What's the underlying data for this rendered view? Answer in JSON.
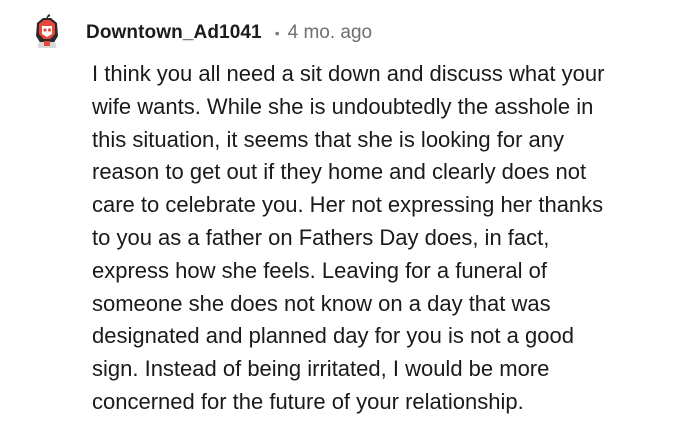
{
  "comment": {
    "author": "Downtown_Ad1041",
    "separator": "•",
    "timestamp": "4 mo. ago",
    "avatar_icon": "snoo-avatar-icon",
    "body_lines": [
      "I think you all need a sit down and discuss what your",
      "wife wants. While she is undoubtedly the asshole in",
      "this situation, it seems that she is looking for any",
      "reason to get out if they home and clearly does not",
      "care to celebrate you. Her not expressing her thanks",
      "to you as a father on Fathers Day does, in fact,",
      "express how she feels. Leaving for a funeral of",
      "someone she does not know on a day that was",
      "designated and planned day for you is not a good",
      "sign. Instead of being irritated, I would be more",
      "concerned for the future of your relationship."
    ]
  },
  "colors": {
    "text": "#1c1c1c",
    "meta": "#6f6f6f",
    "avatar_red": "#e8473b",
    "avatar_dark": "#222222"
  }
}
